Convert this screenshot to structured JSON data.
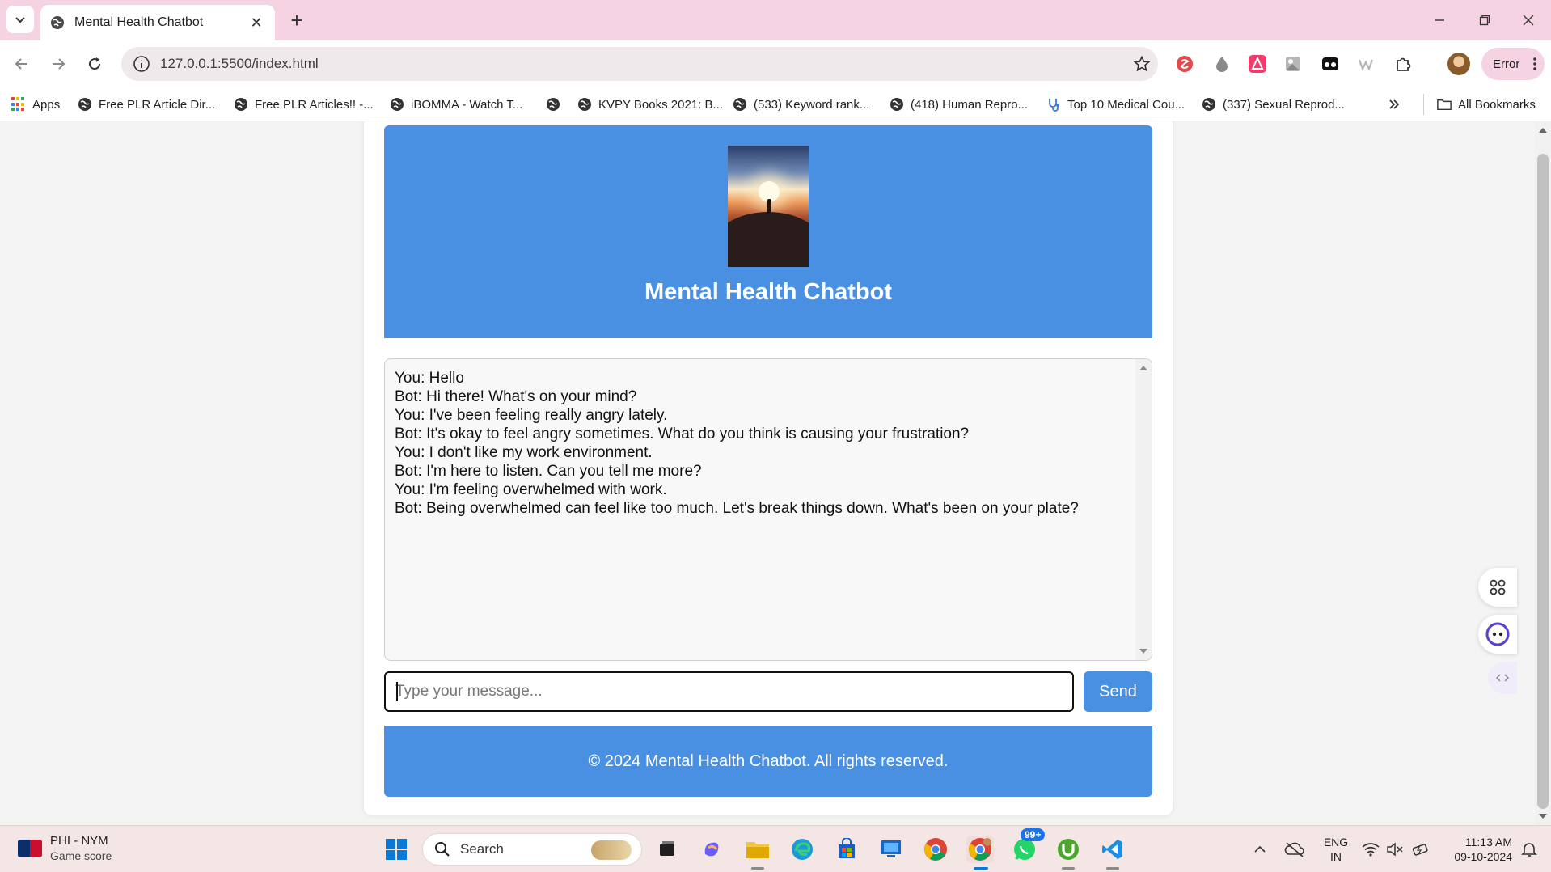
{
  "browser": {
    "tab": {
      "title": "Mental Health Chatbot"
    },
    "address": {
      "url": "127.0.0.1:5500/index.html"
    },
    "profile_status": "Error",
    "bookmarks": [
      {
        "label": "Apps"
      },
      {
        "label": "Free PLR Article Dir..."
      },
      {
        "label": "Free PLR Articles!! -..."
      },
      {
        "label": "iBOMMA - Watch T..."
      },
      {
        "label": ""
      },
      {
        "label": "KVPY Books 2021: B..."
      },
      {
        "label": "(533) Keyword rank..."
      },
      {
        "label": "(418) Human Repro..."
      },
      {
        "label": "Top 10 Medical Cou..."
      },
      {
        "label": "(337) Sexual Reprod..."
      }
    ],
    "all_bookmarks": "All Bookmarks"
  },
  "page": {
    "header": {
      "title": "Mental Health Chatbot"
    },
    "chat": {
      "messages": [
        "You: Hello",
        "Bot: Hi there! What's on your mind?",
        "You: I've been feeling really angry lately.",
        "Bot: It's okay to feel angry sometimes. What do you think is causing your frustration?",
        "You: I don't like my work environment.",
        "Bot: I'm here to listen. Can you tell me more?",
        "You: I'm feeling overwhelmed with work.",
        "Bot: Being overwhelmed can feel like too much. Let's break things down. What's been on your plate?"
      ]
    },
    "input": {
      "placeholder": "Type your message...",
      "value": ""
    },
    "send_label": "Send",
    "footer": "© 2024 Mental Health Chatbot. All rights reserved."
  },
  "taskbar": {
    "weather": {
      "title": "PHI - NYM",
      "subtitle": "Game score"
    },
    "search_label": "Search",
    "whatsapp_badge": "99+",
    "language": {
      "line1": "ENG",
      "line2": "IN"
    },
    "clock": {
      "time": "11:13 AM",
      "date": "09-10-2024"
    }
  },
  "colors": {
    "accent": "#4a90e2",
    "tab_strip": "#f6d3e3",
    "taskbar": "#f3e6e4"
  }
}
